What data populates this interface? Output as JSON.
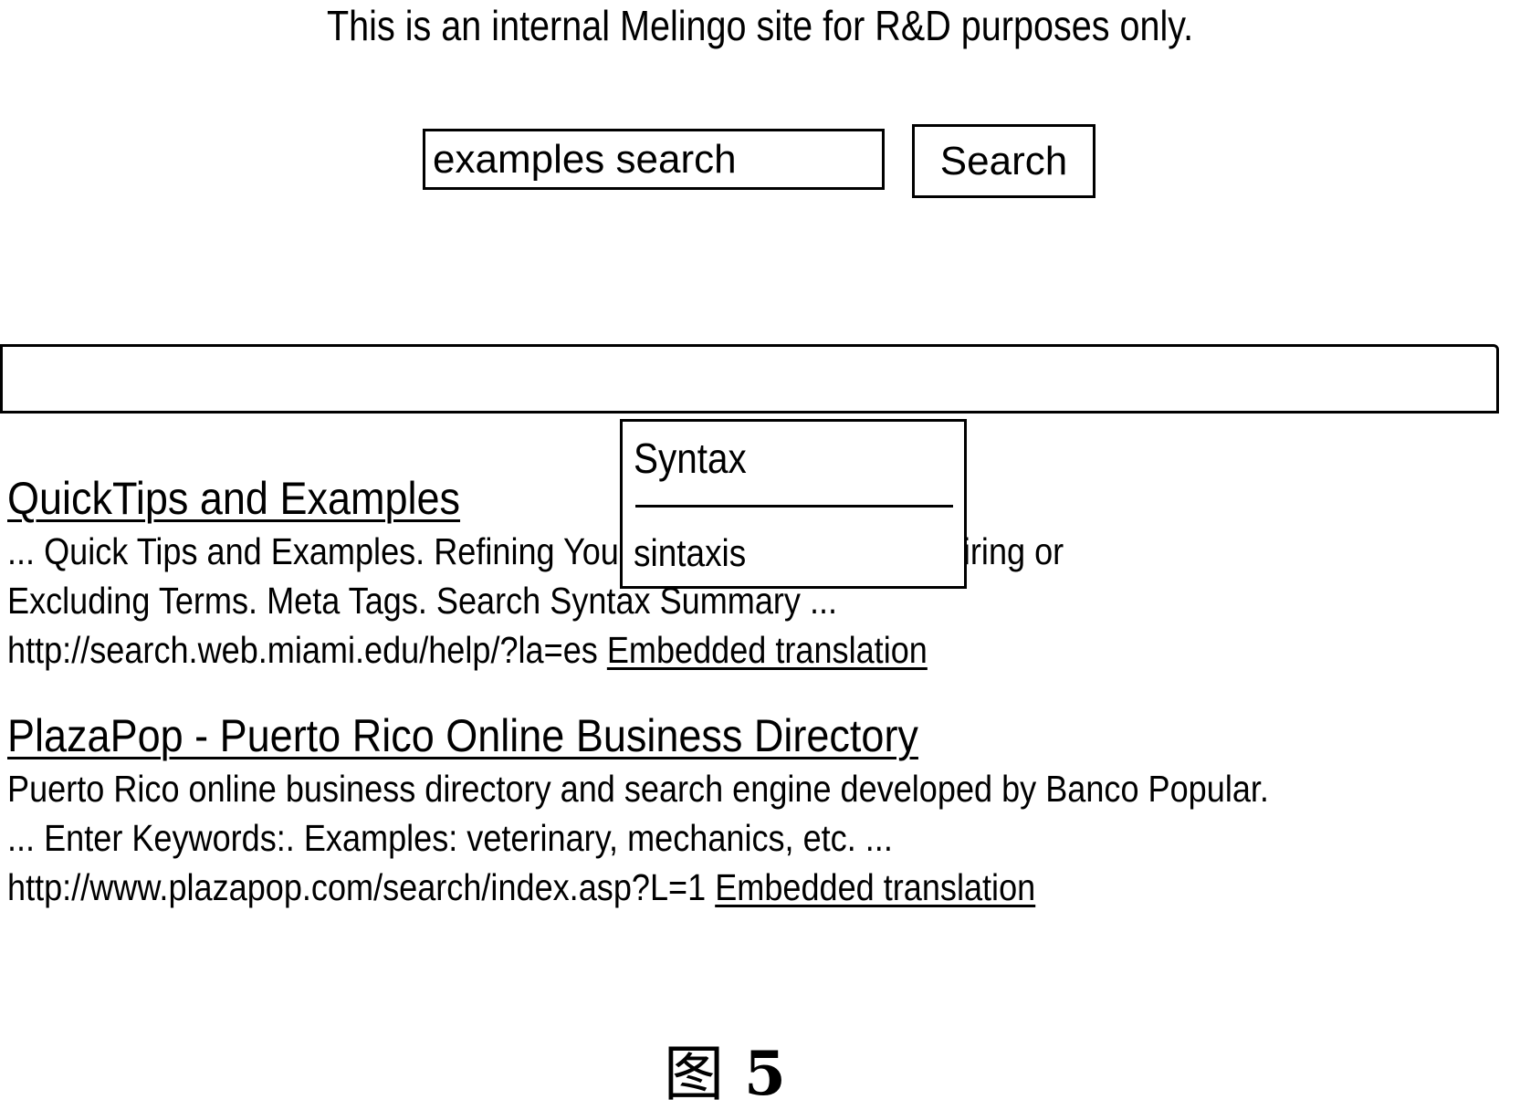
{
  "header": {
    "notice": "This is an internal Melingo site for R&D purposes only."
  },
  "search": {
    "query": "examples search",
    "button_label": "Search"
  },
  "results": [
    {
      "title": "QuickTips and Examples",
      "snippet_lines": [
        "... Quick Tips and Examples. Refining Your Local Searches. Requiring or",
        "Excluding Terms. Meta Tags. Search  Syntax Summary ..."
      ],
      "url": "http://search.web.miami.edu/help/?la=es",
      "translation_link": "Embedded translation"
    },
    {
      "title": "PlazaPop - Puerto Rico Online Business Directory",
      "snippet_lines": [
        "Puerto Rico online business directory and search engine developed by Banco Popular.",
        "... Enter Keywords:.  Examples: veterinary, mechanics, etc. ..."
      ],
      "url": "http://www.plazapop.com/search/index.asp?L=1",
      "translation_link": "Embedded translation"
    }
  ],
  "translation_popup": {
    "term": "Syntax",
    "translation": "sintaxis"
  },
  "figure": {
    "char": "图",
    "number": "5"
  }
}
